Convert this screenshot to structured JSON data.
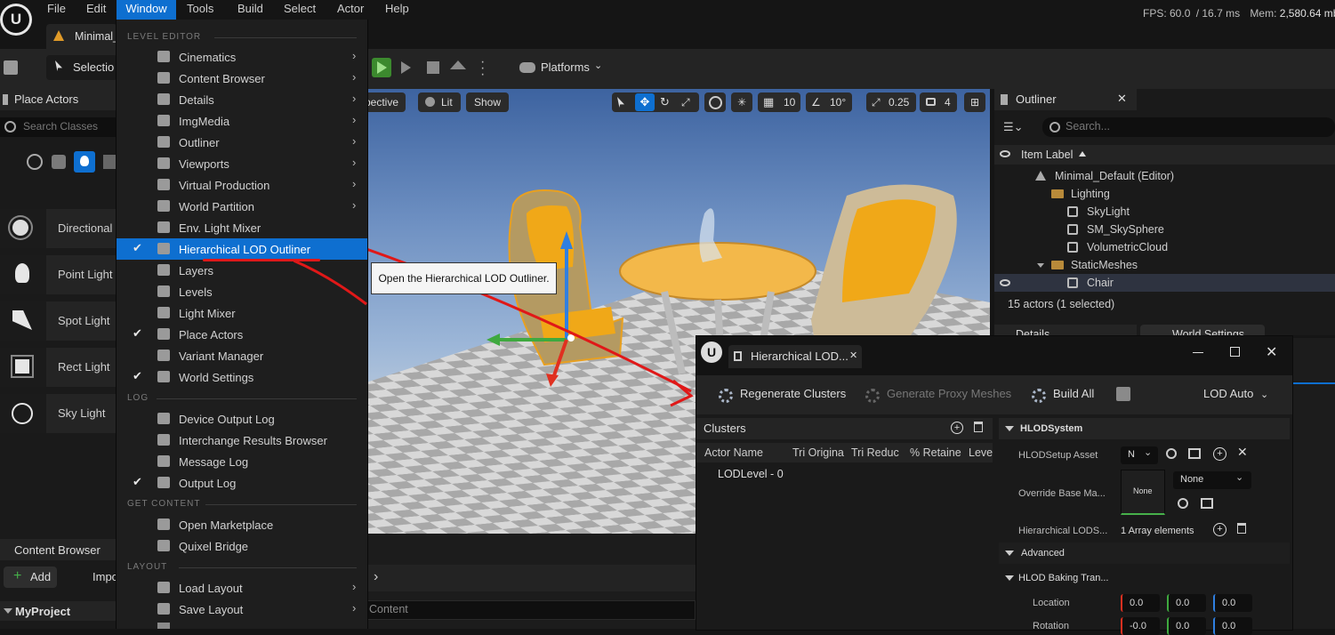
{
  "menubar": {
    "items": [
      "File",
      "Edit",
      "Window",
      "Tools",
      "Build",
      "Select",
      "Actor",
      "Help"
    ],
    "stats": {
      "fps": "FPS: 60.0",
      "ms": "/ 16.7 ms",
      "mem_label": "Mem:",
      "mem_value": "2,580.64 mb"
    }
  },
  "level_tab": {
    "label": "Minimal_"
  },
  "toolbar": {
    "selection_label": "Selectio",
    "platforms_label": "Platforms"
  },
  "left_panel": {
    "title": "Place Actors",
    "search_placeholder": "Search Classes",
    "actors": [
      "Directional",
      "Point Light",
      "Spot Light",
      "Rect Light",
      "Sky Light"
    ],
    "content_browser_tab": "Content Browser",
    "add_label": "Add",
    "import_label": "Impo",
    "project_label": "MyProject"
  },
  "dropdown": {
    "sections": {
      "level_editor": "LEVEL EDITOR",
      "log": "LOG",
      "get_content": "GET CONTENT",
      "layout": "LAYOUT"
    },
    "level_editor_items": [
      {
        "label": "Cinematics",
        "submenu": true,
        "checked": false
      },
      {
        "label": "Content Browser",
        "submenu": true,
        "checked": false
      },
      {
        "label": "Details",
        "submenu": true,
        "checked": false
      },
      {
        "label": "ImgMedia",
        "submenu": true,
        "checked": false
      },
      {
        "label": "Outliner",
        "submenu": true,
        "checked": false
      },
      {
        "label": "Viewports",
        "submenu": true,
        "checked": false
      },
      {
        "label": "Virtual Production",
        "submenu": true,
        "checked": false
      },
      {
        "label": "World Partition",
        "submenu": true,
        "checked": false
      },
      {
        "label": "Env. Light Mixer",
        "submenu": false,
        "checked": false
      },
      {
        "label": "Hierarchical LOD Outliner",
        "submenu": false,
        "checked": true,
        "highlighted": true
      },
      {
        "label": "Layers",
        "submenu": false,
        "checked": false
      },
      {
        "label": "Levels",
        "submenu": false,
        "checked": false
      },
      {
        "label": "Light Mixer",
        "submenu": false,
        "checked": false
      },
      {
        "label": "Place Actors",
        "submenu": false,
        "checked": true
      },
      {
        "label": "Variant Manager",
        "submenu": false,
        "checked": false
      },
      {
        "label": "World Settings",
        "submenu": false,
        "checked": true
      }
    ],
    "log_items": [
      {
        "label": "Device Output Log",
        "checked": false
      },
      {
        "label": "Interchange Results Browser",
        "checked": false
      },
      {
        "label": "Message Log",
        "checked": false
      },
      {
        "label": "Output Log",
        "checked": true
      }
    ],
    "get_content_items": [
      {
        "label": "Open Marketplace"
      },
      {
        "label": "Quixel Bridge"
      }
    ],
    "layout_items": [
      {
        "label": "Load Layout",
        "submenu": true
      },
      {
        "label": "Save Layout",
        "submenu": true
      }
    ]
  },
  "tooltip": {
    "text": "Open the Hierarchical LOD Outliner."
  },
  "viewport": {
    "perspective_label": "pective",
    "lit_label": "Lit",
    "show_label": "Show",
    "grid_value": "10",
    "angle_value": "10°",
    "scale_value": "0.25",
    "camera_speed": "4"
  },
  "content_area": {
    "content_label": "Content"
  },
  "outliner": {
    "title": "Outliner",
    "search_placeholder": "Search...",
    "column_header": "Item Label",
    "rows": [
      {
        "label": "Minimal_Default (Editor)",
        "indent": 1,
        "type": "world"
      },
      {
        "label": "Lighting",
        "indent": 2,
        "type": "folder"
      },
      {
        "label": "SkyLight",
        "indent": 3,
        "type": "actor"
      },
      {
        "label": "SM_SkySphere",
        "indent": 3,
        "type": "actor"
      },
      {
        "label": "VolumetricCloud",
        "indent": 3,
        "type": "actor"
      },
      {
        "label": "StaticMeshes",
        "indent": 2,
        "type": "folder"
      },
      {
        "label": "Chair",
        "indent": 3,
        "type": "actor",
        "selected": true
      }
    ],
    "status": "15 actors (1 selected)",
    "details_tab": "Details",
    "world_settings_tab": "World Settings"
  },
  "hlod": {
    "tab_title": "Hierarchical LOD...",
    "toolbar": {
      "regenerate": "Regenerate Clusters",
      "generate_proxy": "Generate Proxy Meshes",
      "build_all": "Build All",
      "lod_mode": "LOD Auto"
    },
    "clusters": {
      "title": "Clusters",
      "columns": [
        "Actor Name",
        "Tri Origina",
        "Tri Reduc",
        "% Retaine",
        "Leve"
      ],
      "rows": [
        "LODLevel - 0"
      ]
    },
    "details": {
      "hlod_system": "HLODSystem",
      "setup_asset_label": "HLODSetup Asset",
      "setup_asset_value": "N",
      "override_label": "Override Base Ma...",
      "override_thumb": "None",
      "override_value": "None",
      "lods_label": "Hierarchical LODS...",
      "lods_value": "1 Array elements",
      "advanced": "Advanced",
      "baking_label": "HLOD Baking Tran...",
      "location_label": "Location",
      "location": [
        "0.0",
        "0.0",
        "0.0"
      ],
      "rotation_label": "Rotation",
      "rotation": [
        "-0.0",
        "0.0",
        "0.0"
      ]
    }
  },
  "colors": {
    "accent": "#0e6fd0",
    "annotation": "#e01818",
    "x_axis": "#e03020",
    "y_axis": "#3fa93f",
    "z_axis": "#2f7fe0"
  }
}
